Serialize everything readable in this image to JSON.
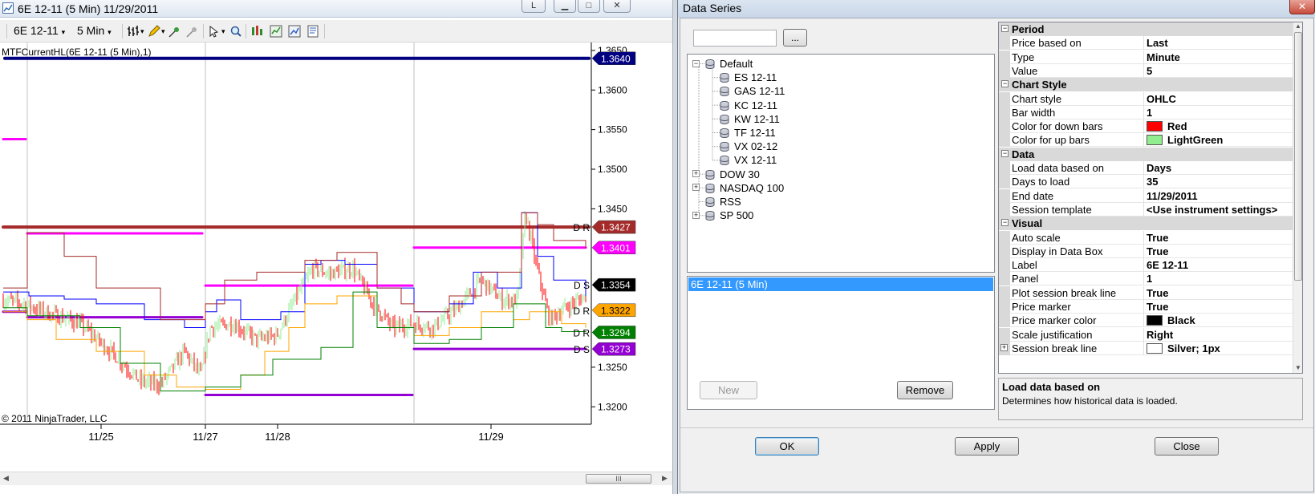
{
  "chart_window": {
    "title": "6E 12-11 (5 Min)  11/29/2011",
    "toolbar": {
      "instrument": "6E 12-11",
      "interval": "5 Min"
    },
    "copyright": "© 2011 NinjaTrader, LLC",
    "scroll_grip": "III"
  },
  "chart_data": {
    "type": "line",
    "title": "MTFCurrentHL(6E 12-11 (5 Min),1)",
    "ylim": [
      1.3178,
      1.366
    ],
    "y_ticks": [
      {
        "label": "1.3650",
        "value": 1.365
      },
      {
        "label": "1.3600",
        "value": 1.36
      },
      {
        "label": "1.3550",
        "value": 1.355
      },
      {
        "label": "1.3500",
        "value": 1.35
      },
      {
        "label": "1.3450",
        "value": 1.345
      },
      {
        "label": "1.3250",
        "value": 1.325
      },
      {
        "label": "1.3200",
        "value": 1.32
      }
    ],
    "x_ticks": [
      "11/25",
      "11/27",
      "11/28",
      "11/29"
    ],
    "price_markers": [
      {
        "label": "1.3640",
        "value": 1.364,
        "color": "#000080",
        "text_color": "#ffffff"
      },
      {
        "label": "1.3427",
        "value": 1.3427,
        "color": "#a52a2a",
        "text_color": "#ffffff"
      },
      {
        "label": "1.3401",
        "value": 1.3401,
        "color": "#ff00ff",
        "text_color": "#ffffff"
      },
      {
        "label": "1.3354",
        "value": 1.3354,
        "color": "#000000",
        "text_color": "#ffffff"
      },
      {
        "label": "1.3322",
        "value": 1.3322,
        "color": "#ffa500",
        "text_color": "#000000"
      },
      {
        "label": "1.3294",
        "value": 1.3294,
        "color": "#008000",
        "text_color": "#ffffff"
      },
      {
        "label": "1.3273",
        "value": 1.3273,
        "color": "#9400d3",
        "text_color": "#ffffff"
      }
    ],
    "line_tags": [
      {
        "text": "D R",
        "value": 1.3427
      },
      {
        "text": "D S",
        "value": 1.3354
      },
      {
        "text": "D R",
        "value": 1.3322
      },
      {
        "text": "D R",
        "value": 1.3294
      },
      {
        "text": "D S",
        "value": 1.3273
      }
    ],
    "colors": {
      "up_bars": "#90ee90",
      "down_bars": "#ff0000",
      "session_break": "#c0c0c0",
      "level_navy": "#000080",
      "level_brown": "#a52a2a",
      "level_magenta": "#ff00ff",
      "level_purple": "#9400d3",
      "step_blue": "#0000ff",
      "step_brown": "#a52a2a",
      "step_orange": "#ffa500",
      "step_green": "#008000"
    }
  },
  "dialog": {
    "title": "Data Series",
    "close_label": "✕",
    "browse_label": "...",
    "tree": [
      {
        "label": "Default",
        "expanded": true,
        "children": [
          "ES 12-11",
          "GAS 12-11",
          "KC 12-11",
          "KW 12-11",
          "TF 12-11",
          "VX 02-12",
          "VX 12-11"
        ]
      },
      {
        "label": "DOW 30",
        "expanded": false
      },
      {
        "label": "NASDAQ 100",
        "expanded": false
      },
      {
        "label": "RSS",
        "expanded": null
      },
      {
        "label": "SP 500",
        "expanded": false
      }
    ],
    "selected_series": [
      "6E 12-11 (5 Min)"
    ],
    "buttons": {
      "new": "New",
      "remove": "Remove",
      "ok": "OK",
      "apply": "Apply",
      "close": "Close"
    },
    "properties": [
      {
        "category": "Period",
        "rows": [
          {
            "name": "Price based on",
            "value": "Last"
          },
          {
            "name": "Type",
            "value": "Minute"
          },
          {
            "name": "Value",
            "value": "5"
          }
        ]
      },
      {
        "category": "Chart Style",
        "rows": [
          {
            "name": "Chart style",
            "value": "OHLC"
          },
          {
            "name": "Bar width",
            "value": "1"
          },
          {
            "name": "Color for down bars",
            "value": "Red",
            "swatch": "#ff0000"
          },
          {
            "name": "Color for up bars",
            "value": "LightGreen",
            "swatch": "#90ee90"
          }
        ]
      },
      {
        "category": "Data",
        "rows": [
          {
            "name": "Load data based on",
            "value": "Days"
          },
          {
            "name": "Days to load",
            "value": "35"
          },
          {
            "name": "End date",
            "value": "11/29/2011"
          },
          {
            "name": "Session template",
            "value": "<Use instrument settings>"
          }
        ]
      },
      {
        "category": "Visual",
        "rows": [
          {
            "name": "Auto scale",
            "value": "True"
          },
          {
            "name": "Display in Data Box",
            "value": "True"
          },
          {
            "name": "Label",
            "value": "6E 12-11"
          },
          {
            "name": "Panel",
            "value": "1"
          },
          {
            "name": "Plot session break line",
            "value": "True"
          },
          {
            "name": "Price marker",
            "value": "True"
          },
          {
            "name": "Price marker color",
            "value": "Black",
            "swatch": "#000000"
          },
          {
            "name": "Scale justification",
            "value": "Right"
          },
          {
            "name": "Session break line",
            "value": "Silver; 1px",
            "swatch": "#ffffff",
            "expandable": true
          }
        ]
      }
    ],
    "description": {
      "title": "Load data based on",
      "text": "Determines how historical data is loaded."
    }
  }
}
